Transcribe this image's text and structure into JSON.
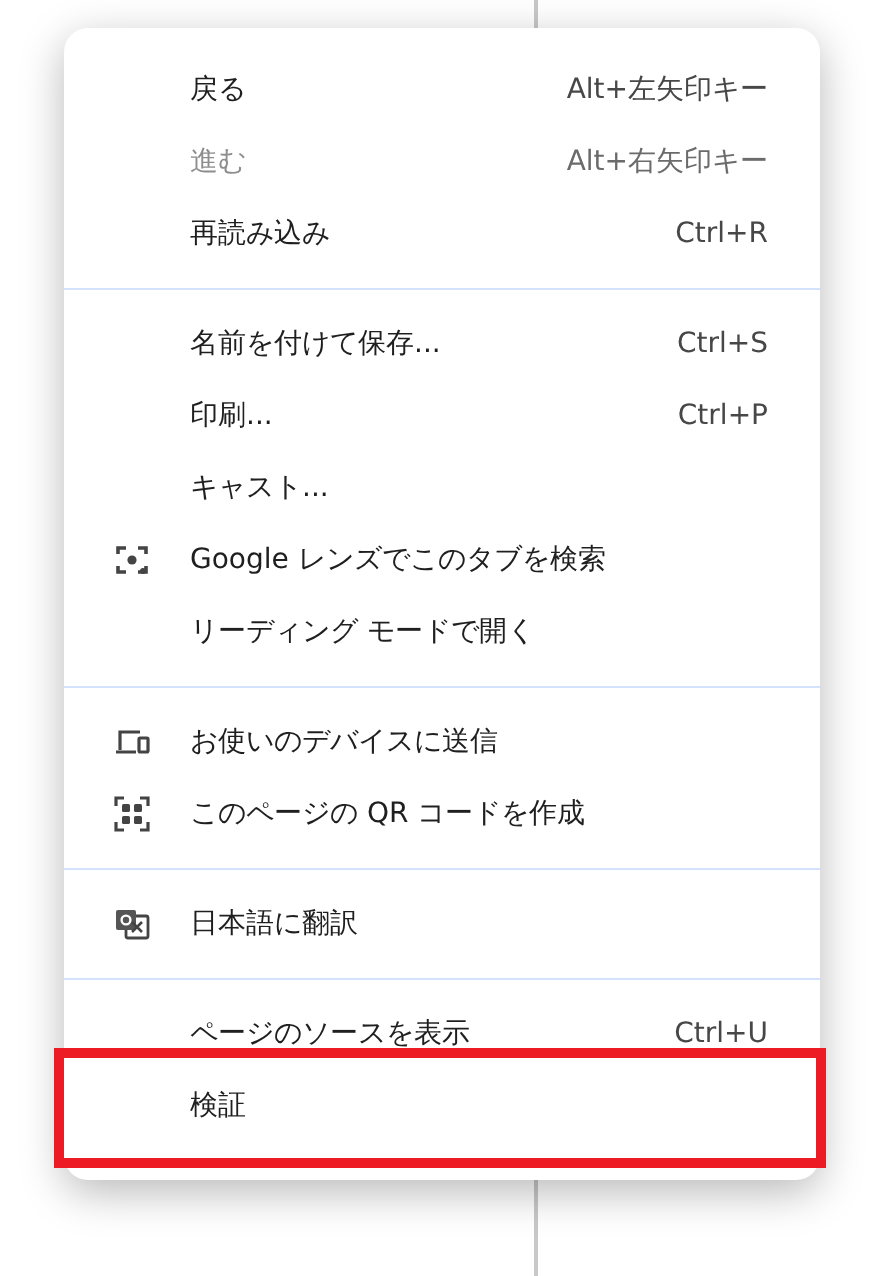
{
  "menu": {
    "sections": [
      {
        "items": [
          {
            "kind": "plain",
            "label": "戻る",
            "shortcut": "Alt+左矢印キー",
            "disabled": false,
            "highlighted": false
          },
          {
            "kind": "plain",
            "label": "進む",
            "shortcut": "Alt+右矢印キー",
            "disabled": true,
            "highlighted": false
          },
          {
            "kind": "plain",
            "label": "再読み込み",
            "shortcut": "Ctrl+R",
            "disabled": false,
            "highlighted": false
          }
        ]
      },
      {
        "items": [
          {
            "kind": "plain",
            "label": "名前を付けて保存...",
            "shortcut": "Ctrl+S",
            "disabled": false,
            "highlighted": false
          },
          {
            "kind": "plain",
            "label": "印刷...",
            "shortcut": "Ctrl+P",
            "disabled": false,
            "highlighted": false
          },
          {
            "kind": "plain",
            "label": "キャスト...",
            "disabled": false,
            "highlighted": false
          },
          {
            "kind": "lens",
            "label": "Google レンズでこのタブを検索",
            "disabled": false,
            "highlighted": false
          },
          {
            "kind": "plain",
            "label": "リーディング モードで開く",
            "disabled": false,
            "highlighted": false
          }
        ]
      },
      {
        "items": [
          {
            "kind": "devices",
            "label": "お使いのデバイスに送信",
            "disabled": false,
            "highlighted": false
          },
          {
            "kind": "qr",
            "label": "このページの QR コードを作成",
            "disabled": false,
            "highlighted": false
          }
        ]
      },
      {
        "items": [
          {
            "kind": "translate",
            "label": "日本語に翻訳",
            "disabled": false,
            "highlighted": false
          }
        ]
      },
      {
        "items": [
          {
            "kind": "plain",
            "label": "ページのソースを表示",
            "shortcut": "Ctrl+U",
            "disabled": false,
            "highlighted": false
          },
          {
            "kind": "plain",
            "label": "検証",
            "disabled": false,
            "highlighted": true
          }
        ]
      }
    ]
  }
}
